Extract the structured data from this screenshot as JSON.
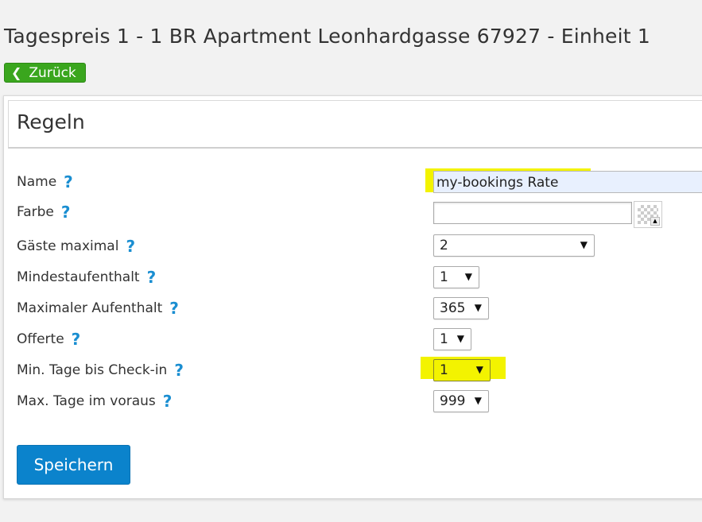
{
  "page": {
    "title": "Tagespreis 1 - 1 BR Apartment Leonhardgasse 67927 - Einheit 1",
    "back_label": "Zurück"
  },
  "panel": {
    "title": "Regeln",
    "help_glyph": "?",
    "fields": {
      "name": {
        "label": "Name",
        "value": "my-bookings Rate"
      },
      "color": {
        "label": "Farbe",
        "value": ""
      },
      "max_guests": {
        "label": "Gäste maximal",
        "value": "2"
      },
      "min_stay": {
        "label": "Mindestaufenthalt",
        "value": "1"
      },
      "max_stay": {
        "label": "Maximaler Aufenthalt",
        "value": "365"
      },
      "offer": {
        "label": "Offerte",
        "value": "1"
      },
      "min_days_checkin": {
        "label": "Min. Tage bis Check-in",
        "value": "1"
      },
      "max_days_advance": {
        "label": "Max. Tage im voraus",
        "value": "999"
      }
    },
    "save_label": "Speichern"
  },
  "icons": {
    "back": "chevron-left-icon",
    "help": "question-mark-icon",
    "dropdown": "triangle-down-icon"
  },
  "colors": {
    "background": "#f2f2f2",
    "back_button": "#3aa61e",
    "save_button": "#0b83cc",
    "help_icon": "#1a8ed1",
    "highlight": "#f3f300"
  }
}
